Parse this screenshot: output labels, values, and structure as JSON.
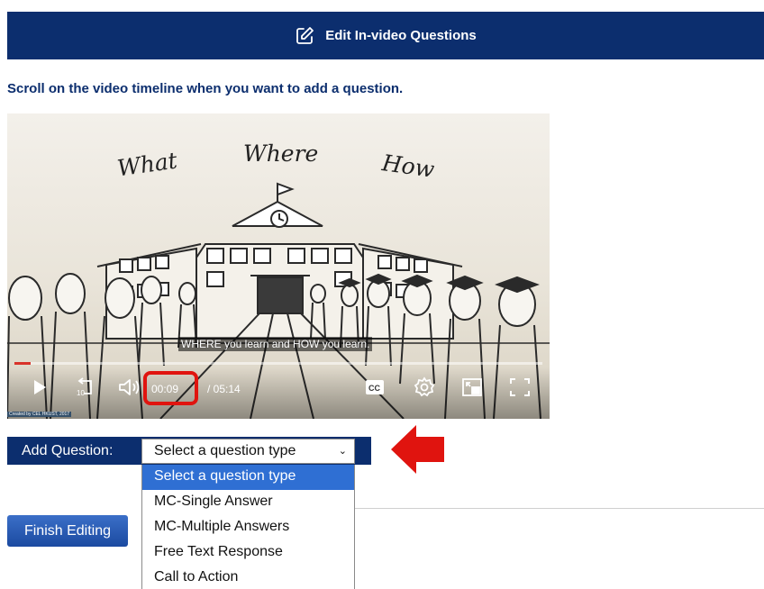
{
  "header": {
    "title": "Edit In-video Questions",
    "icon": "edit-icon"
  },
  "instruction": "Scroll on the video timeline when you want to add a question.",
  "video": {
    "scene_words": [
      "What",
      "Where",
      "How"
    ],
    "caption": "WHERE you learn and HOW you learn.",
    "progress": 0.03,
    "current_time": "00:09",
    "total_time": "/ 05:14",
    "credit": "Created by CEL HKUST, 2017",
    "cc_label": "CC",
    "accent_color": "#d8322a"
  },
  "add_question": {
    "label": "Add Question:",
    "selected": "Select a question type",
    "options": [
      "Select a question type",
      "MC-Single Answer",
      "MC-Multiple Answers",
      "Free Text Response",
      "Call to Action"
    ]
  },
  "finish_label": "Finish Editing",
  "colors": {
    "navy": "#0c2e6e",
    "highlight_red": "#e0140f",
    "option_blue": "#2f6fd3"
  }
}
